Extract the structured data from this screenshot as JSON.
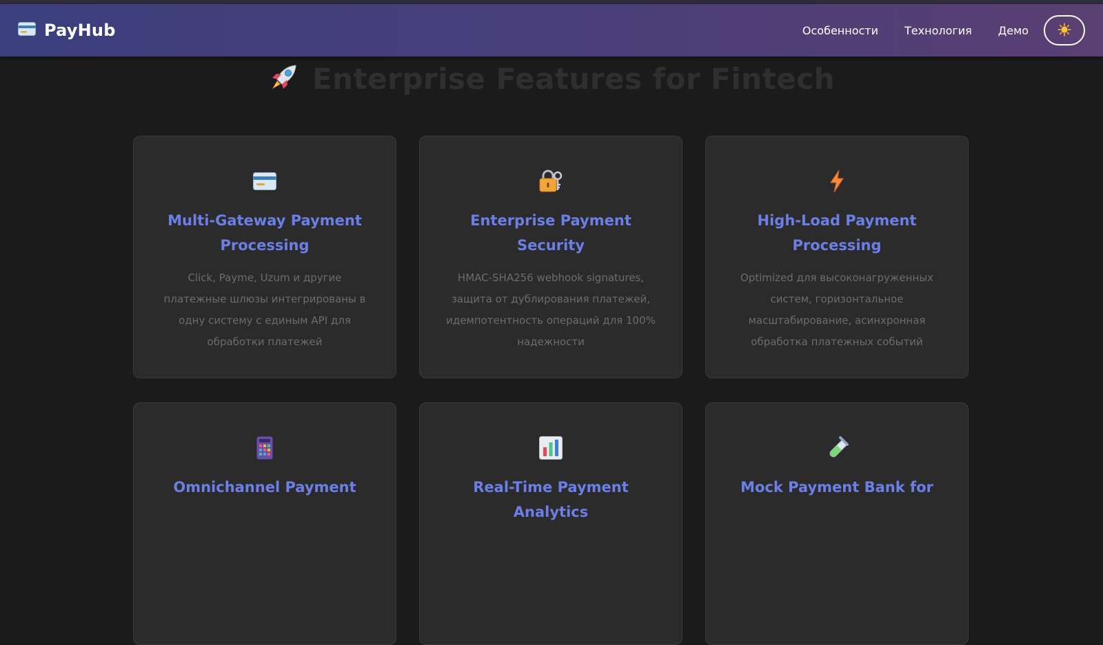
{
  "brand": {
    "name": "PayHub",
    "icon": "credit-card-icon"
  },
  "nav": {
    "links": [
      "Особенности",
      "Технология",
      "Демо"
    ],
    "theme_toggle_icon": "sun-icon"
  },
  "hero": {
    "title": "Enterprise Features for Fintech",
    "icon": "rocket-icon"
  },
  "features": [
    {
      "icon": "credit-card-icon",
      "title": "Multi-Gateway Payment Processing",
      "description": "Click, Payme, Uzum и другие платежные шлюзы интегрированы в одну систему с единым API для обработки платежей"
    },
    {
      "icon": "lock-key-icon",
      "title": "Enterprise Payment Security",
      "description": "HMAC-SHA256 webhook signatures, защита от дублирования платежей, идемпотентность операций для 100% надежности"
    },
    {
      "icon": "lightning-icon",
      "title": "High-Load Payment Processing",
      "description": "Optimized для высоконагруженных систем, горизонтальное масштабирование, асинхронная обработка платежных событий"
    },
    {
      "icon": "calculator-icon",
      "title": "Omnichannel Payment",
      "description": ""
    },
    {
      "icon": "bar-chart-icon",
      "title": "Real-Time Payment Analytics",
      "description": ""
    },
    {
      "icon": "test-tube-icon",
      "title": "Mock Payment Bank for",
      "description": ""
    }
  ],
  "colors": {
    "accent": "#6b7fe6",
    "navbar_start": "#3b3f7d",
    "navbar_end": "#5a3f72",
    "background": "#1b1b1b",
    "card": "#2b2b2b"
  }
}
